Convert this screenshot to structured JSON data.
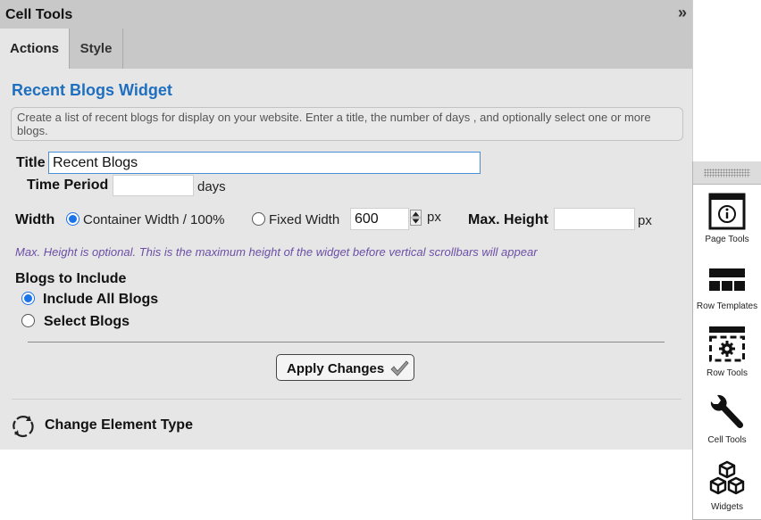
{
  "panel": {
    "title": "Cell Tools",
    "collapse_icon": "double-chevron-right-icon",
    "tabs": [
      {
        "label": "Actions",
        "active": true
      },
      {
        "label": "Style",
        "active": false
      }
    ]
  },
  "widget": {
    "heading": "Recent Blogs Widget",
    "description": "Create a list of recent blogs for display on your website. Enter a title, the number of days , and optionally select one or more blogs."
  },
  "form": {
    "title_label": "Title",
    "title_value": "Recent Blogs",
    "time_period_label": "Time Period",
    "time_period_value": "",
    "time_period_unit": "days",
    "width_label": "Width",
    "width_options": [
      {
        "label": "Container Width / 100%",
        "selected": true
      },
      {
        "label": "Fixed Width",
        "selected": false
      }
    ],
    "fixed_width_value": "600",
    "fixed_width_unit": "px",
    "max_height_label": "Max. Height",
    "max_height_value": "",
    "max_height_unit": "px",
    "max_height_hint": "Max. Height is optional. This is the maximum height of the widget before vertical scrollbars will appear",
    "blogs_label": "Blogs to Include",
    "blog_options": [
      {
        "label": "Include All Blogs",
        "selected": true
      },
      {
        "label": "Select Blogs",
        "selected": false
      }
    ],
    "apply_label": "Apply Changes",
    "change_type_label": "Change Element Type"
  },
  "toolbar": {
    "items": [
      {
        "label": "Page Tools",
        "icon": "page-info-icon"
      },
      {
        "label": "Row Templates",
        "icon": "row-layout-icon"
      },
      {
        "label": "Row Tools",
        "icon": "row-gear-icon"
      },
      {
        "label": "Cell Tools",
        "icon": "wrench-icon"
      },
      {
        "label": "Widgets",
        "icon": "cubes-icon"
      }
    ]
  },
  "colors": {
    "accent_blue": "#1e6fbf",
    "hint_purple": "#6c4fa6",
    "radio_blue": "#1a73e8",
    "panel_bg": "#e6e6e6",
    "header_bg": "#c8c8c8"
  }
}
